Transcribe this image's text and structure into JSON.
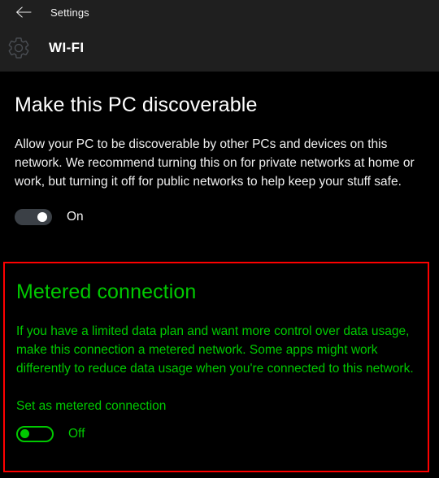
{
  "titlebar": {
    "back_icon": "back-arrow-icon",
    "title": "Settings"
  },
  "page_header": {
    "icon": "gear-icon",
    "title": "WI-FI"
  },
  "discoverable": {
    "heading": "Make this PC discoverable",
    "body": "Allow your PC to be discoverable by other PCs and devices on this network. We recommend turning this on for private networks at home or work, but turning it off for public networks to help keep your stuff safe.",
    "toggle_state_label": "On",
    "toggle_value": "on"
  },
  "metered": {
    "heading": "Metered connection",
    "body": "If you have a limited data plan and want more control over data usage, make this connection a metered network. Some apps might work differently to reduce data usage when you're connected to this network.",
    "sublabel": "Set as metered connection",
    "toggle_state_label": "Off",
    "toggle_value": "off"
  },
  "colors": {
    "background": "#000000",
    "header_background": "#1f1f1f",
    "text_primary": "#ffffff",
    "highlight_green": "#00c900",
    "highlight_red": "#fe0000",
    "toggle_on_track": "#3b4046"
  }
}
